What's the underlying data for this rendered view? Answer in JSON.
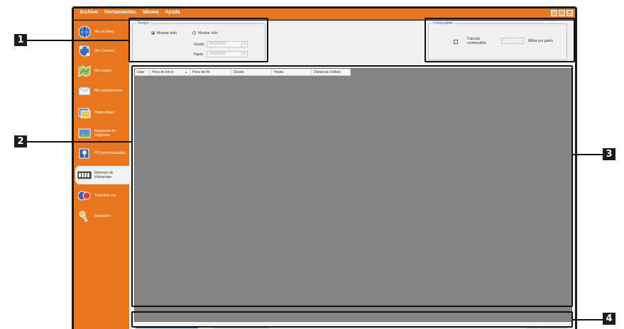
{
  "menu": {
    "items": [
      "Archivo",
      "Herramientas",
      "Idioma",
      "Ayuda"
    ]
  },
  "window_buttons": {
    "minimize": "_",
    "maximize": "□",
    "close": "×"
  },
  "sidebar": {
    "items": [
      {
        "label": "Mio en línea",
        "icon": "globe-icon"
      },
      {
        "label": "Mio Connect",
        "icon": "connect-globe-icon"
      },
      {
        "label": "Mis mapas",
        "icon": "map-icon"
      },
      {
        "label": "Mis suscripciones",
        "icon": "envelope-icon"
      },
      {
        "label": "Photo Album",
        "icon": "photo-album-icon"
      },
      {
        "label": "Búsqueda de imágenes",
        "icon": "image-search-icon"
      },
      {
        "label": "POI personalizados",
        "icon": "poi-icon"
      },
      {
        "label": "Informes de kilometraje",
        "icon": "odometer-icon"
      },
      {
        "label": "Transferir voz",
        "icon": "voice-icon"
      },
      {
        "label": "Activación",
        "icon": "key-icon"
      }
    ],
    "active_index": 7
  },
  "tiempo": {
    "title": "Tiempo",
    "radio_all": "Mostrar todo",
    "radio_only": "Mostrar sólo",
    "from_label": "Desde",
    "to_label": "Hasta",
    "from_value": "4/02/2008",
    "to_value": "4/02/2008"
  },
  "combustible": {
    "title": "Combustible",
    "checkbox_label": "Calcular combustible",
    "number_value": "0",
    "unit_label": "Millas por galón"
  },
  "table": {
    "columns": [
      "Usar",
      "Hora de inicio",
      "Hora de fin",
      "Desde",
      "Hasta",
      "Distancia (millas)"
    ],
    "sort_indicator": "▲"
  },
  "callouts": [
    "1",
    "2",
    "3",
    "4"
  ],
  "colors": {
    "accent": "#e8761e",
    "table_bg": "#858585",
    "group_title": "#3b5ea8"
  }
}
